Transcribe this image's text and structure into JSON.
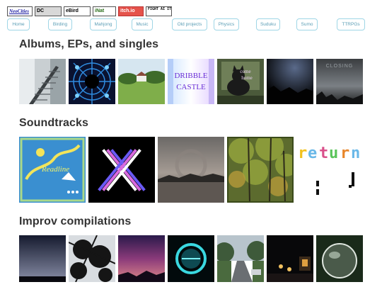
{
  "badges": [
    "NeoCities",
    "DC",
    "eBird",
    "iNat",
    "itch.io",
    "FIGHT AI ITEM PUB"
  ],
  "nav": [
    "Home",
    "Birding",
    "Mahjong",
    "Music",
    "Old projects",
    "Physics",
    "Suduku",
    "Sumo",
    "TTRPGs"
  ],
  "sections": {
    "albums": {
      "heading": "Albums, EPs, and singles",
      "items": [
        {
          "icon": "staircase-photo"
        },
        {
          "icon": "kaleidoscope-art"
        },
        {
          "icon": "farmhouse-field-photo"
        },
        {
          "icon": "dribble-castle-cover",
          "text": "DRIBBLE CASTLE"
        },
        {
          "icon": "cat-in-window-cover",
          "text": "come home"
        },
        {
          "icon": "dark-night-sky-photo"
        },
        {
          "icon": "storm-clouds-cover",
          "text": "CLOSING"
        }
      ]
    },
    "soundtracks": {
      "heading": "Soundtracks",
      "items": [
        {
          "icon": "handdrawn-map-cover",
          "text": "Readline"
        },
        {
          "icon": "neon-x-logo"
        },
        {
          "icon": "misty-lake-photo"
        },
        {
          "icon": "autumn-forest-photo"
        },
        {
          "icon": "return-pixel-text",
          "text": "return"
        }
      ]
    },
    "improv": {
      "heading": "Improv compilations",
      "items": [
        {
          "icon": "dusk-sky-photo"
        },
        {
          "icon": "tree-silhouette-photo"
        },
        {
          "icon": "purple-sunset-photo"
        },
        {
          "icon": "neon-ring-art"
        },
        {
          "icon": "suburban-street-photo"
        },
        {
          "icon": "night-lanterns-photo"
        },
        {
          "icon": "glass-sphere-photo"
        }
      ]
    }
  },
  "colors": {
    "nav_border": "#9fd6e6",
    "nav_text": "#5a9db5",
    "heading": "#333333"
  }
}
